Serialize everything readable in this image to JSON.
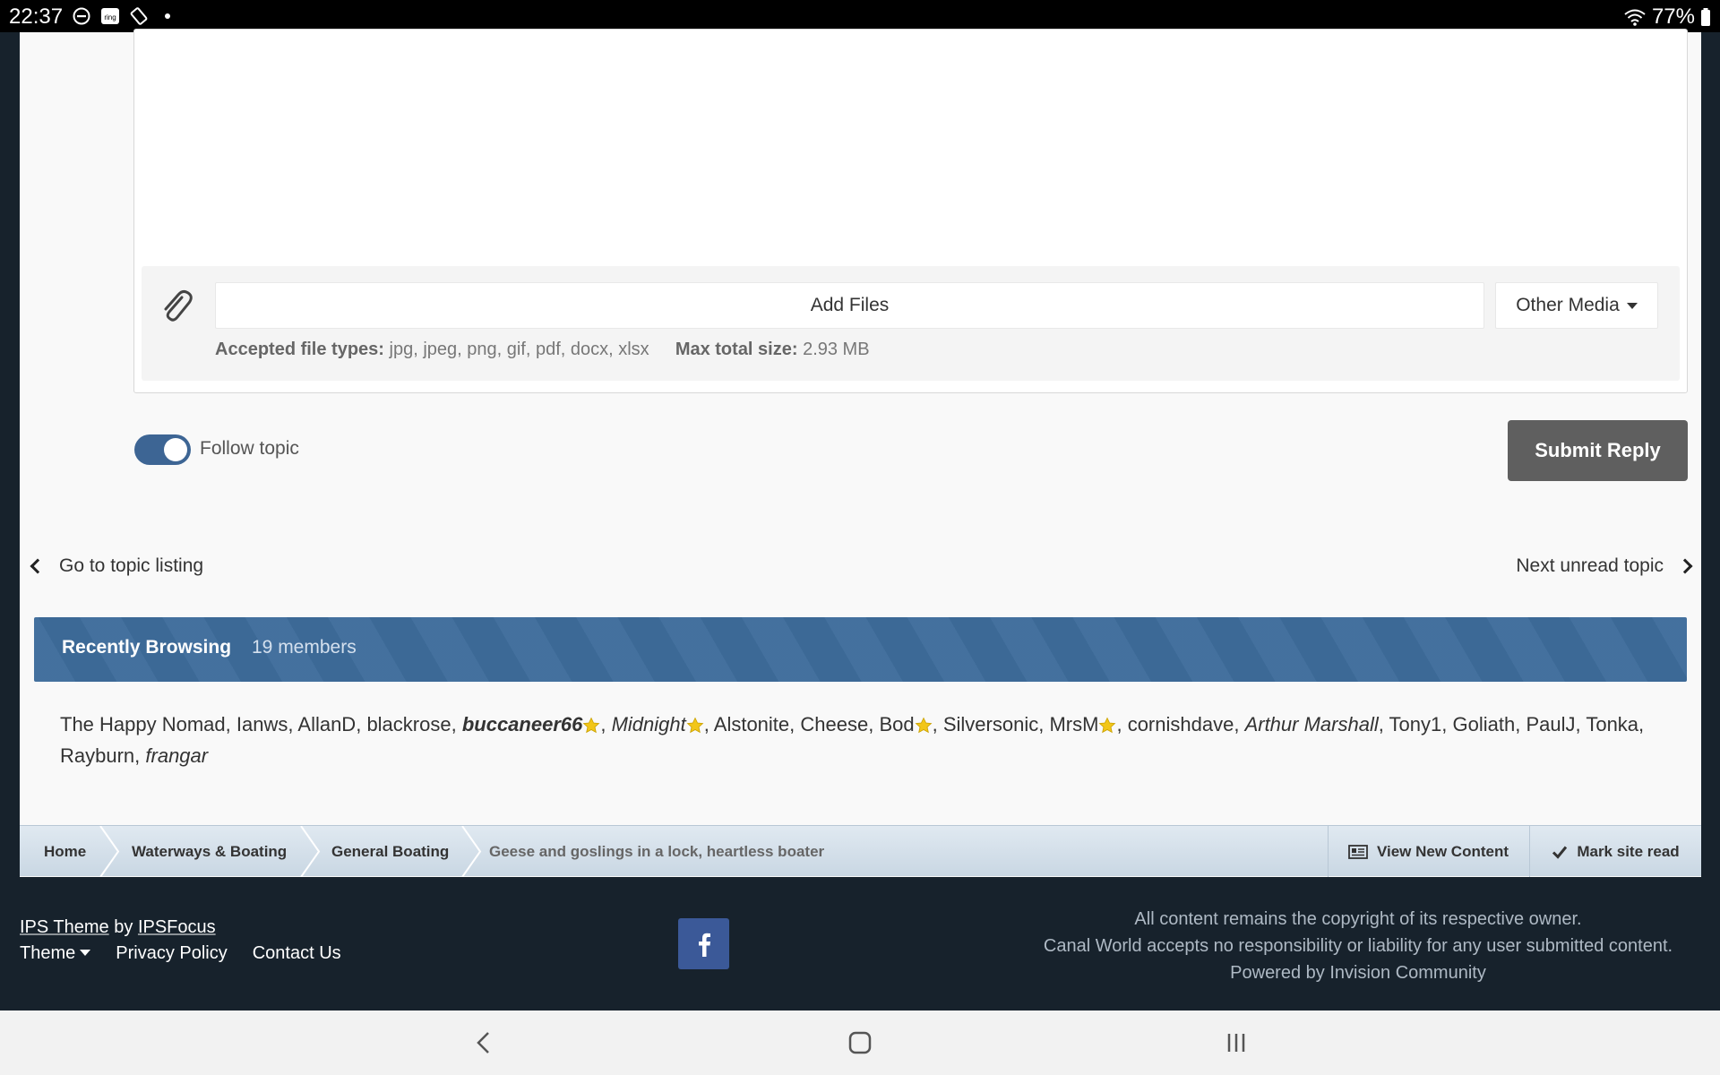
{
  "status_bar": {
    "time": "22:37",
    "left_icons": [
      "do-not-disturb-icon",
      "ring-app-icon",
      "rotation-lock-icon",
      "dot-icon"
    ],
    "battery": "77%",
    "right_icons": [
      "wifi-icon",
      "battery-icon"
    ]
  },
  "editor": {
    "attach_icon": "paperclip-icon",
    "add_files_label": "Add Files",
    "other_media_label": "Other Media",
    "accepted_types_label": "Accepted file types:",
    "accepted_types_value": "jpg, jpeg, png, gif, pdf, docx, xlsx",
    "max_size_label": "Max total size:",
    "max_size_value": "2.93 MB"
  },
  "follow": {
    "label": "Follow topic",
    "enabled": true
  },
  "submit_label": "Submit Reply",
  "topic_nav": {
    "prev_label": "Go to topic listing",
    "next_label": "Next unread topic"
  },
  "recently_browsing": {
    "title": "Recently Browsing",
    "count": "19 members",
    "members": [
      {
        "name": "The Happy Nomad",
        "style": "normal",
        "star": false
      },
      {
        "name": "Ianws",
        "style": "normal",
        "star": false
      },
      {
        "name": "AllanD",
        "style": "normal",
        "star": false
      },
      {
        "name": "blackrose",
        "style": "normal",
        "star": false
      },
      {
        "name": "buccaneer66",
        "style": "bold-italic",
        "star": true
      },
      {
        "name": "Midnight",
        "style": "italic",
        "star": true
      },
      {
        "name": "Alstonite",
        "style": "normal",
        "star": false
      },
      {
        "name": "Cheese",
        "style": "normal",
        "star": false
      },
      {
        "name": "Bod",
        "style": "normal",
        "star": true
      },
      {
        "name": "Silversonic",
        "style": "normal",
        "star": false
      },
      {
        "name": "MrsM",
        "style": "normal",
        "star": true
      },
      {
        "name": "cornishdave",
        "style": "normal",
        "star": false
      },
      {
        "name": "Arthur Marshall",
        "style": "italic",
        "star": false
      },
      {
        "name": "Tony1",
        "style": "normal",
        "star": false
      },
      {
        "name": "Goliath",
        "style": "normal",
        "star": false
      },
      {
        "name": "PaulJ",
        "style": "normal",
        "star": false
      },
      {
        "name": "Tonka",
        "style": "normal",
        "star": false
      },
      {
        "name": "Rayburn",
        "style": "normal",
        "star": false
      },
      {
        "name": "frangar",
        "style": "italic",
        "star": false
      }
    ]
  },
  "breadcrumb": {
    "items": [
      "Home",
      "Waterways & Boating",
      "General Boating"
    ],
    "current": "Geese and goslings in a lock, heartless boater",
    "view_new_content": "View New Content",
    "mark_site_read": "Mark site read"
  },
  "footer": {
    "theme_credit_1": "IPS Theme",
    "theme_credit_by": " by ",
    "theme_credit_2": "IPSFocus",
    "theme_label": "Theme",
    "privacy_label": "Privacy Policy",
    "contact_label": "Contact Us",
    "social_icon": "facebook-icon",
    "copyright_1": "All content remains the copyright of its respective owner.",
    "copyright_2": "Canal World accepts no responsibility or liability for any user submitted content.",
    "powered_by": "Powered by Invision Community"
  },
  "colors": {
    "header_blue": "#3e6c9b",
    "toggle_on": "#3d6594",
    "submit_bg": "#5f5f5f",
    "footer_bg": "#17222c",
    "facebook": "#3b5998",
    "star": "#f2c618"
  }
}
